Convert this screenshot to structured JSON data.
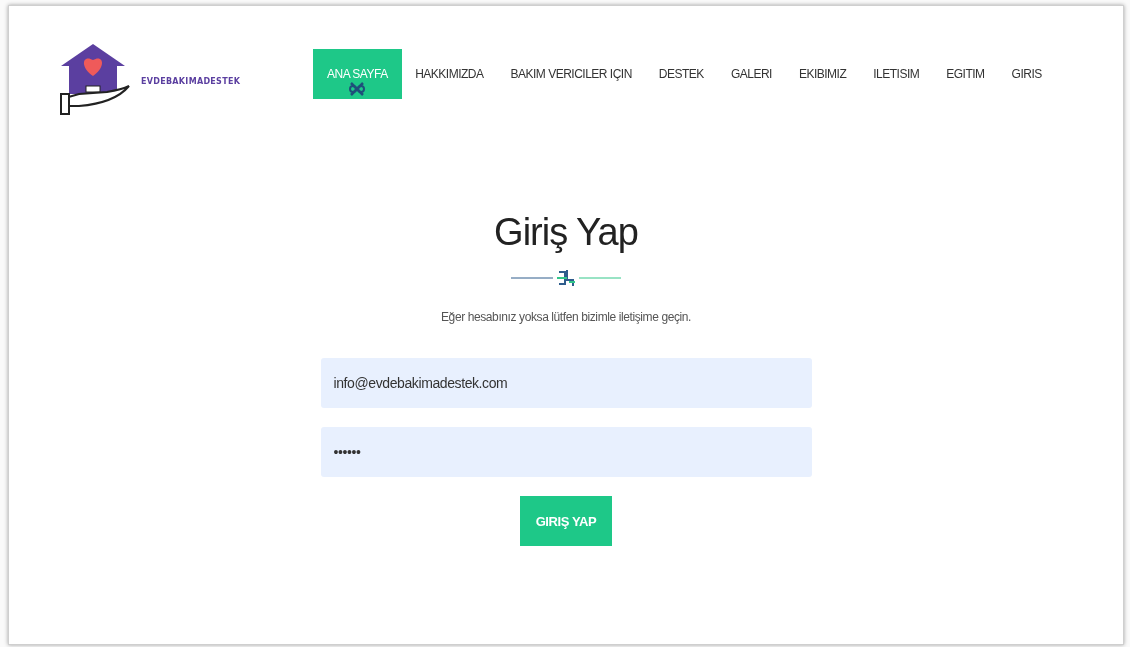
{
  "logo": {
    "name": "EVDEBAKIMADESTEK"
  },
  "nav": [
    {
      "label": "ANA SAYFA",
      "selected": true
    },
    {
      "label": "HAKKIMIZDA",
      "selected": false
    },
    {
      "label": "BAKIM VERICILER IÇIN",
      "selected": false
    },
    {
      "label": "DESTEK",
      "selected": false
    },
    {
      "label": "GALERI",
      "selected": false
    },
    {
      "label": "EKIBIMIZ",
      "selected": false
    },
    {
      "label": "ILETISIM",
      "selected": false
    },
    {
      "label": "EGITIM",
      "selected": false
    },
    {
      "label": "GIRIS",
      "selected": false
    }
  ],
  "login": {
    "title": "Giriş Yap",
    "subtitle": "Eğer hesabınız yoksa lütfen bizimle iletişime geçin.",
    "email": {
      "value": "info@evdebakimadestek.com"
    },
    "password": {
      "value": "••••••"
    },
    "button": "GIRIŞ YAP"
  }
}
